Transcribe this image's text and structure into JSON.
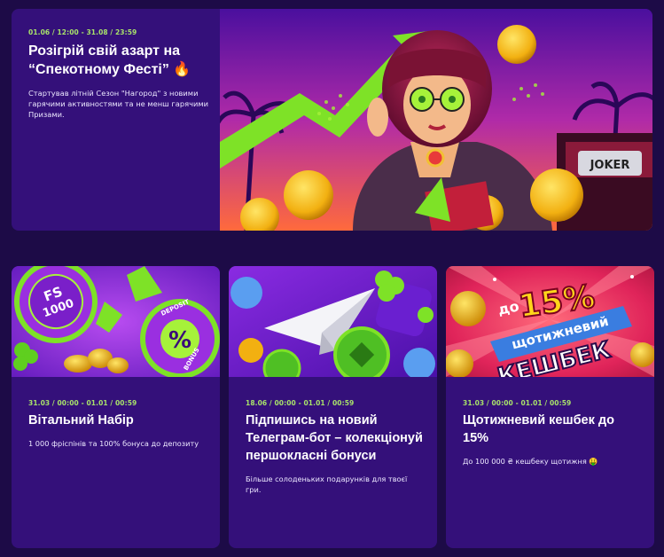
{
  "hero": {
    "date": "01.06 / 12:00 - 31.08 / 23:59",
    "title": "Розігрій свій азарт на “Спекотному Фесті” 🔥",
    "description": "Стартував літній Сезон \"Нагород\" з новими гарячими активностями та не менш гарячими Призами.",
    "image_plate": "JOKER"
  },
  "promos": [
    {
      "date": "31.03 / 00:00 - 01.01 / 00:59",
      "title": "Вітальний Набір",
      "description": "1 000 фріспінів та 100% бонуса до депозиту",
      "image_labels": {
        "chip1": "FS",
        "chip1b": "1000",
        "chip2": "%",
        "chip2_top": "DEPOSIT",
        "chip2_bottom": "BONUS"
      }
    },
    {
      "date": "18.06 / 00:00 - 01.01 / 00:59",
      "title": "Підпишись на новий Телеграм-бот – колекціонуй першокласні бонуси",
      "description": "Більше солоденьких подарунків для твоєї гри."
    },
    {
      "date": "31.03 / 00:00 - 01.01 / 00:59",
      "title": "Щотижневий кешбек до 15%",
      "description": "До 100 000 ₴ кешбеку щотижня 🤑",
      "image_labels": {
        "small": "до",
        "big": "15%",
        "ribbon": "щотижневий",
        "main": "КЕШБЕК"
      }
    }
  ]
}
